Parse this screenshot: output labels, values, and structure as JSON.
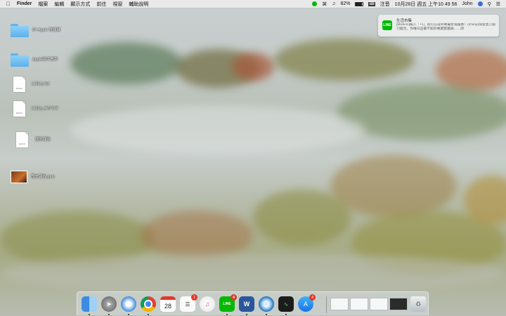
{
  "menubar": {
    "app": "Finder",
    "menus": [
      "檔案",
      "編輯",
      "顯示方式",
      "前往",
      "視窗",
      "輔助說明"
    ],
    "battery_percent": "82%",
    "battery_level": 0.82,
    "input_method": "注音",
    "datetime": "10月28日 週五 上午10 49 56",
    "user": "John"
  },
  "desktop": {
    "items": [
      {
        "label": "07-Apple 快捷鍵",
        "icon": "folder-icon"
      },
      {
        "label": "Apple新手教學",
        "icon": "folder-icon"
      },
      {
        "label": "にほんHM",
        "icon": "docx-icon",
        "badge": "DOCX"
      },
      {
        "label": "にほんごのです",
        "icon": "docx-icon",
        "badge": "DOCX"
      },
      {
        "label": "國防報告",
        "icon": "docx-icon",
        "badge": "DOCX"
      },
      {
        "label": "歷史報告.pptx",
        "icon": "pptx-icon"
      }
    ]
  },
  "notification": {
    "app_icon": "LINE",
    "title": "生活市集",
    "message": "[Mission]輸入「+1」就可以得到專屬折價優惠！(shimp)限量雙刀鍛刀組合，你唯日品最不能的專業雙層鍋……請"
  },
  "dock": {
    "apps": [
      {
        "name": "Finder",
        "icon": "finder-icon",
        "running": true
      },
      {
        "name": "Launchpad",
        "icon": "launchpad-icon",
        "running": true
      },
      {
        "name": "Safari",
        "icon": "safari-icon",
        "running": true
      },
      {
        "name": "Chrome",
        "icon": "chrome-icon",
        "running": true
      },
      {
        "name": "Calendar",
        "icon": "calendar-icon",
        "running": false,
        "text": "28"
      },
      {
        "name": "Reminders",
        "icon": "reminders-icon",
        "running": false,
        "badge": "1"
      },
      {
        "name": "iTunes",
        "icon": "itunes-icon",
        "running": false
      },
      {
        "name": "LINE",
        "icon": "line-icon",
        "running": true,
        "badge": "4",
        "text": "LINE"
      },
      {
        "name": "Word",
        "icon": "word-icon",
        "running": true,
        "text": "W"
      },
      {
        "name": "QuickTime",
        "icon": "quicktime-icon",
        "running": true
      },
      {
        "name": "Activity Monitor",
        "icon": "activity-monitor-icon",
        "running": true
      },
      {
        "name": "App Store",
        "icon": "app-store-icon",
        "running": false,
        "badge": "4"
      }
    ],
    "windows": [
      "minimized-window-1",
      "minimized-window-2",
      "minimized-window-3",
      "minimized-window-4"
    ]
  },
  "colors": {
    "line_green": "#00b900",
    "badge_red": "#e2382c",
    "folder_blue": "#5ab0ec"
  }
}
